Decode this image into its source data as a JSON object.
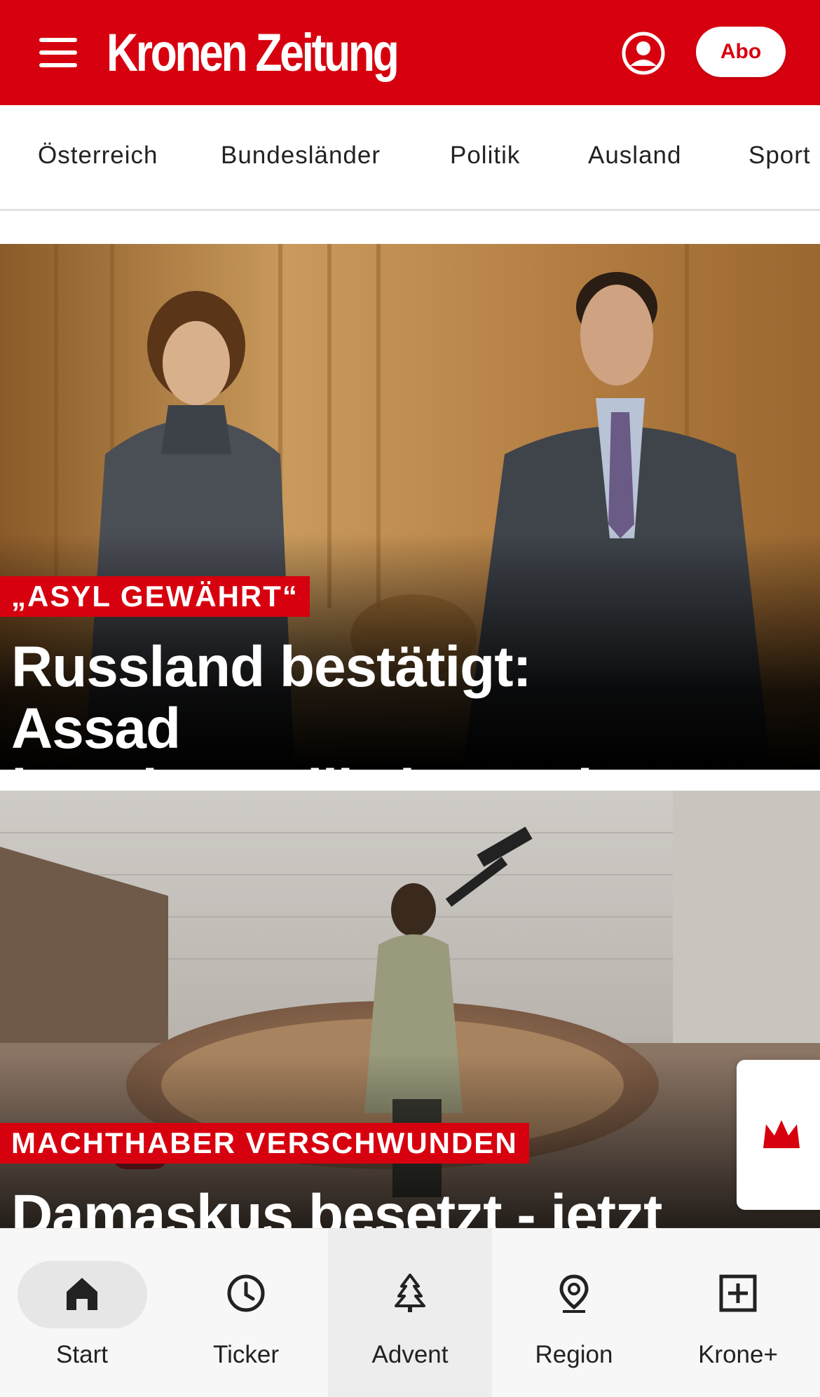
{
  "header": {
    "logo": "Kronen Zeitung",
    "abo_label": "Abo"
  },
  "nav": {
    "items": [
      "Österreich",
      "Bundesländer",
      "Politik",
      "Ausland",
      "Sport"
    ]
  },
  "articles": [
    {
      "kicker": "„ASYL GEWÄHRT“",
      "headline_line1": "Russland bestätigt: Assad",
      "headline_line2": "ist mit Familie in Moskau"
    },
    {
      "kicker": "MACHTHABER VERSCHWUNDEN",
      "headline_line1": "Damaskus besetzt - jetzt"
    }
  ],
  "bottom_nav": {
    "items": [
      {
        "label": "Start",
        "icon": "home-icon",
        "active": true
      },
      {
        "label": "Ticker",
        "icon": "clock-icon"
      },
      {
        "label": "Advent",
        "icon": "tree-icon"
      },
      {
        "label": "Region",
        "icon": "location-pin-icon"
      },
      {
        "label": "Krone+",
        "icon": "plus-box-icon"
      }
    ]
  },
  "colors": {
    "brand_red": "#d7000f",
    "nav_text": "#222222"
  }
}
